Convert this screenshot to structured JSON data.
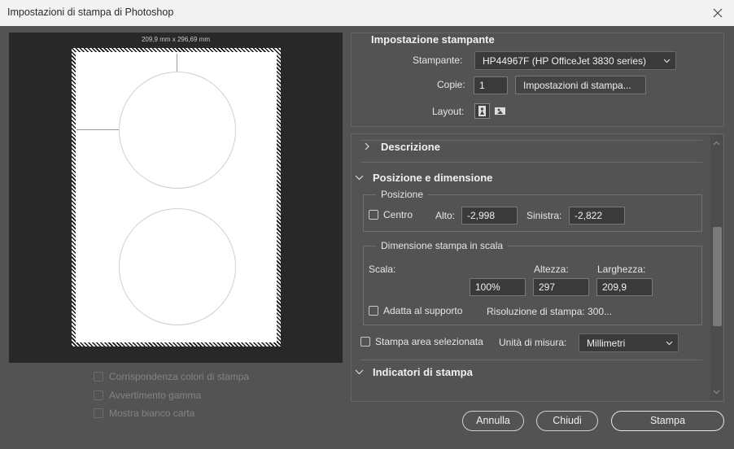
{
  "window": {
    "title": "Impostazioni di stampa di Photoshop"
  },
  "preview": {
    "paper_size": "209,9 mm x 296,69 mm",
    "options": [
      {
        "label": "Corrispondenza colori di stampa",
        "checked": false,
        "enabled": false
      },
      {
        "label": "Avvertimento gamma",
        "checked": false,
        "enabled": false
      },
      {
        "label": "Mostra bianco carta",
        "checked": false,
        "enabled": false
      }
    ]
  },
  "printer_setup": {
    "heading": "Impostazione stampante",
    "printer_label": "Stampante:",
    "printer_value": "HP44967F (HP OfficeJet 3830 series)",
    "copies_label": "Copie:",
    "copies_value": "1",
    "print_settings_button": "Impostazioni di stampa...",
    "layout_label": "Layout:",
    "layout_icons": [
      "portrait-layout-icon",
      "landscape-layout-icon"
    ]
  },
  "sections": {
    "description": {
      "label": "Descrizione",
      "expanded": false
    },
    "position_size": {
      "label": "Posizione e dimensione",
      "expanded": true,
      "position": {
        "legend": "Posizione",
        "center_label": "Centro",
        "center_checked": false,
        "top_label": "Alto:",
        "top_value": "-2,998",
        "left_label": "Sinistra:",
        "left_value": "-2,822"
      },
      "scaled": {
        "legend": "Dimensione stampa in scala",
        "scale_label": "Scala:",
        "scale_value": "100%",
        "height_label": "Altezza:",
        "height_value": "297",
        "width_label": "Larghezza:",
        "width_value": "209,9",
        "fit_label": "Adatta al supporto",
        "fit_checked": false,
        "resolution": "Risoluzione di stampa: 300..."
      },
      "print_selected_label": "Stampa area selezionata",
      "print_selected_checked": false,
      "units_label": "Unità di misura:",
      "units_value": "Millimetri"
    },
    "marks": {
      "label": "Indicatori di stampa",
      "expanded": true
    }
  },
  "footer": {
    "cancel": "Annulla",
    "close": "Chiudi",
    "print": "Stampa"
  }
}
